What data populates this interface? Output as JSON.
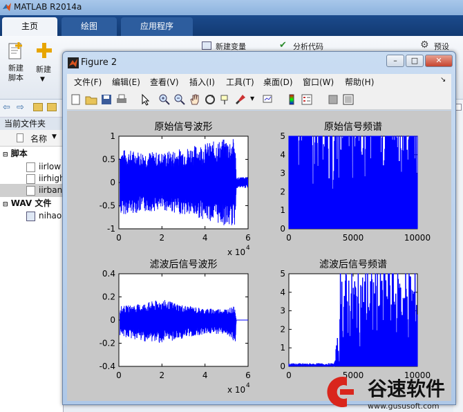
{
  "app": {
    "title": "MATLAB R2014a"
  },
  "tabs": [
    {
      "label": "主页"
    },
    {
      "label": "绘图"
    },
    {
      "label": "应用程序"
    }
  ],
  "ribbon": {
    "new_script": "新建\n脚本",
    "new_script_l1": "新建",
    "new_script_l2": "脚本",
    "new": "新建",
    "new_variable": "新建变量",
    "analyze_code": "分析代码",
    "preferences": "预设"
  },
  "file_browser": {
    "current_folder": "当前文件夹",
    "column_name": "名称",
    "groups": [
      {
        "label": "脚本",
        "files": [
          "iirlow",
          "iirhigh",
          "iirban"
        ]
      },
      {
        "label": "WAV 文件",
        "files": [
          "nihao"
        ]
      }
    ]
  },
  "figure": {
    "title": "Figure 2",
    "menus": [
      "文件(F)",
      "编辑(E)",
      "查看(V)",
      "插入(I)",
      "工具(T)",
      "桌面(D)",
      "窗口(W)",
      "帮助(H)"
    ],
    "window_buttons": {
      "minimize": "–",
      "maximize": "□",
      "close": "✕"
    }
  },
  "colors": {
    "plot_line": "#0000ff",
    "figure_bg": "#c8c8c8",
    "tab_bar": "#1b4a8c"
  },
  "chart_data": [
    {
      "type": "line",
      "title": "原始信号波形",
      "xlim": [
        0,
        6
      ],
      "ylim": [
        -1,
        1
      ],
      "xticks": [
        "0",
        "2",
        "4",
        "6"
      ],
      "yticks": [
        "-1",
        "-0.5",
        "0",
        "0.5",
        "1"
      ],
      "x_multiplier": "x 10",
      "x_exponent": "4",
      "envelope": {
        "x": [
          0.05,
          1,
          2,
          3,
          4,
          5,
          5.4,
          5.45,
          6
        ],
        "upper": [
          0.72,
          0.68,
          0.65,
          0.75,
          0.85,
          0.95,
          0.95,
          0.12,
          0.12
        ],
        "lower": [
          -0.7,
          -0.65,
          -0.6,
          -0.7,
          -0.8,
          -0.95,
          -0.95,
          -0.12,
          -0.12
        ]
      }
    },
    {
      "type": "line",
      "title": "原始信号频谱",
      "xlim": [
        0,
        10000
      ],
      "ylim": [
        0,
        5
      ],
      "xticks": [
        "0",
        "5000",
        "10000"
      ],
      "yticks": [
        "0",
        "1",
        "2",
        "3",
        "4",
        "5"
      ]
    },
    {
      "type": "line",
      "title": "滤波后信号波形",
      "xlim": [
        0,
        6
      ],
      "ylim": [
        -0.4,
        0.4
      ],
      "xticks": [
        "0",
        "2",
        "4",
        "6"
      ],
      "yticks": [
        "-0.4",
        "-0.2",
        "0",
        "0.2",
        "0.4"
      ],
      "x_multiplier": "x 10",
      "x_exponent": "4",
      "envelope": {
        "x": [
          0.05,
          1,
          2,
          3,
          4,
          5,
          5.4,
          5.45,
          6
        ],
        "upper": [
          0.12,
          0.14,
          0.18,
          0.13,
          0.1,
          0.1,
          0.12,
          0.0,
          0.0
        ],
        "lower": [
          -0.14,
          -0.18,
          -0.2,
          -0.16,
          -0.12,
          -0.12,
          -0.24,
          0.0,
          0.0
        ]
      }
    },
    {
      "type": "line",
      "title": "滤波后信号频谱",
      "xlim": [
        0,
        10000
      ],
      "ylim": [
        0,
        5
      ],
      "xticks": [
        "0",
        "5000",
        "10000"
      ],
      "yticks": [
        "0",
        "1",
        "2",
        "3",
        "4",
        "5"
      ]
    }
  ],
  "watermark": {
    "brand": "谷速软件",
    "url": "www.gususoft.com"
  }
}
